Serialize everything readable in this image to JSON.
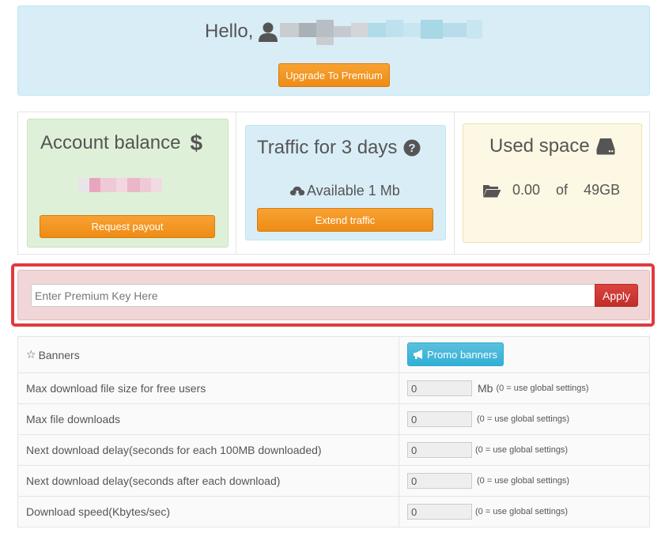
{
  "header": {
    "greeting": "Hello,",
    "upgrade_label": "Upgrade To Premium"
  },
  "balance": {
    "title": "Account balance",
    "icon": "dollar-icon",
    "payout_label": "Request payout"
  },
  "traffic": {
    "title": "Traffic for 3 days",
    "available": "Available 1 Mb",
    "extend_label": "Extend traffic"
  },
  "space": {
    "title": "Used space",
    "used": "0.00",
    "of": "of",
    "total": "49GB"
  },
  "premium_key": {
    "placeholder": "Enter Premium Key Here",
    "apply_label": "Apply"
  },
  "settings": {
    "banners_label": "Banners",
    "promo_label": "Promo banners",
    "rows": [
      {
        "label": "Max download file size for free users",
        "value": "0",
        "unit": "Mb",
        "hint": "(0 = use global settings)"
      },
      {
        "label": "Max file downloads",
        "value": "0",
        "unit": "",
        "hint": "(0 = use global settings)"
      },
      {
        "label": "Next download delay(seconds for each 100MB downloaded)",
        "value": "0",
        "unit": "",
        "hint": "(0 = use global settings)"
      },
      {
        "label": "Next download delay(seconds after each download)",
        "value": "0",
        "unit": "",
        "hint": "(0 = use global settings)"
      },
      {
        "label": "Download speed(Kbytes/sec)",
        "value": "0",
        "unit": "",
        "hint": "(0 = use global settings)"
      }
    ]
  },
  "colors": {
    "info_bg": "#d9edf7",
    "success_bg": "#dff0d8",
    "warning_bg": "#fcf8e3",
    "danger_bg": "#f0d6d6",
    "orange_button": "#f0961f",
    "red_button": "#c9302c",
    "cyan_button": "#5bc0de",
    "highlight_border": "#e03a3e"
  }
}
